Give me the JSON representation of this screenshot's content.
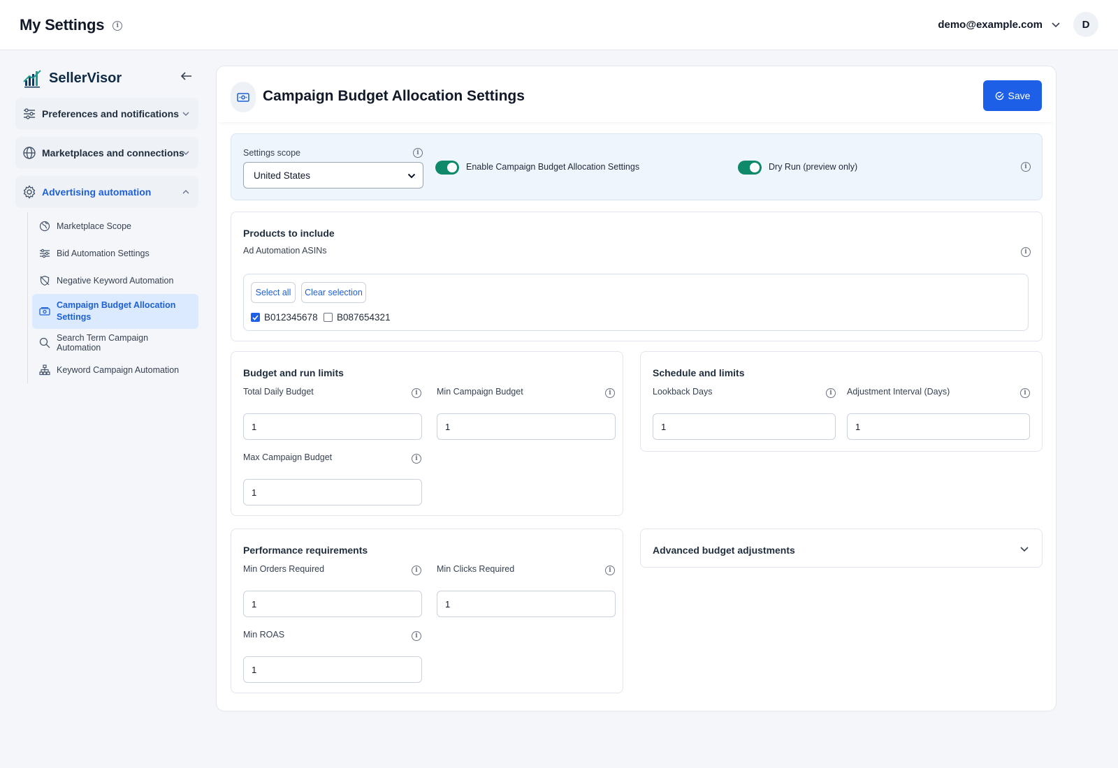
{
  "header": {
    "title": "My Settings",
    "user_email": "demo@example.com",
    "avatar_initial": "D"
  },
  "sidebar": {
    "brand": "SellerVisor",
    "groups": [
      {
        "label": "Preferences and notifications",
        "icon": "sliders-icon",
        "expanded": false
      },
      {
        "label": "Marketplaces and connections",
        "icon": "globe-icon",
        "expanded": false
      },
      {
        "label": "Advertising automation",
        "icon": "gear-icon",
        "expanded": true
      }
    ],
    "subitems": [
      {
        "label": "Marketplace Scope",
        "icon": "globe-icon"
      },
      {
        "label": "Bid Automation Settings",
        "icon": "sliders-icon"
      },
      {
        "label": "Negative Keyword Automation",
        "icon": "shield-off-icon"
      },
      {
        "label": "Campaign Budget Allocation Settings",
        "icon": "money-icon",
        "active": true
      },
      {
        "label": "Search Term Campaign Automation",
        "icon": "search-icon"
      },
      {
        "label": "Keyword Campaign Automation",
        "icon": "hierarchy-icon"
      }
    ]
  },
  "main": {
    "title": "Campaign Budget Allocation Settings",
    "save_label": "Save",
    "scope": {
      "label": "Settings scope",
      "selected": "United States",
      "enable_label": "Enable Campaign Budget Allocation Settings",
      "enable_on": true,
      "dry_run_label": "Dry Run (preview only)",
      "dry_run_on": true
    },
    "products": {
      "title": "Products to include",
      "asins_label": "Ad Automation ASINs",
      "select_all": "Select all",
      "clear_selection": "Clear selection",
      "asins": [
        {
          "id": "B012345678",
          "checked": true
        },
        {
          "id": "B087654321",
          "checked": false
        }
      ]
    },
    "budget": {
      "title": "Budget and run limits",
      "total_daily_label": "Total Daily Budget",
      "total_daily_value": "1",
      "min_campaign_label": "Min Campaign Budget",
      "min_campaign_value": "1",
      "max_campaign_label": "Max Campaign Budget",
      "max_campaign_value": "1"
    },
    "schedule": {
      "title": "Schedule and limits",
      "lookback_label": "Lookback Days",
      "lookback_value": "1",
      "interval_label": "Adjustment Interval (Days)",
      "interval_value": "1"
    },
    "performance": {
      "title": "Performance requirements",
      "min_orders_label": "Min Orders Required",
      "min_orders_value": "1",
      "min_clicks_label": "Min Clicks Required",
      "min_clicks_value": "1",
      "min_roas_label": "Min ROAS",
      "min_roas_value": "1"
    },
    "advanced": {
      "title": "Advanced budget adjustments"
    }
  },
  "colors": {
    "accent": "#1d5fe6",
    "toggle_on": "#0e8a6a",
    "active_nav_bg": "#dbeafe",
    "scope_card_bg": "#eff5fd"
  }
}
